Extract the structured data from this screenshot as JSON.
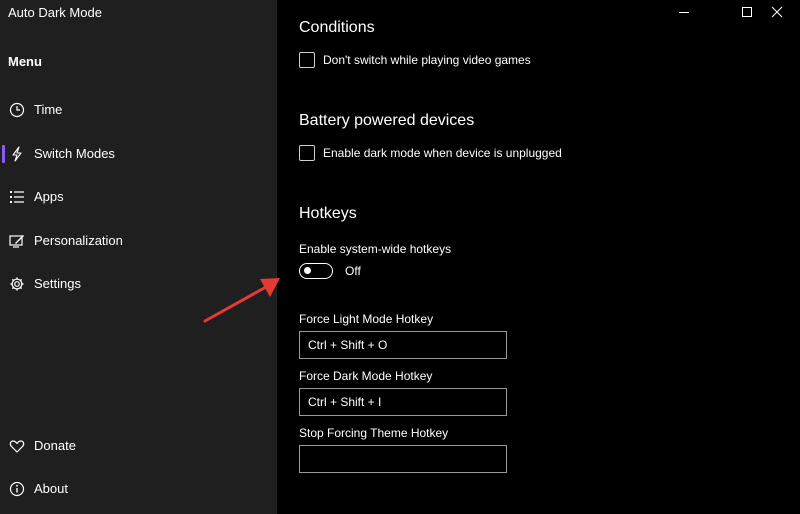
{
  "app": {
    "title": "Auto Dark Mode"
  },
  "window_controls": {
    "minimize": "minimize-icon",
    "maximize": "maximize-icon",
    "close": "close-icon"
  },
  "sidebar": {
    "menu_heading": "Menu",
    "items": [
      {
        "label": "Time",
        "icon": "clock-icon"
      },
      {
        "label": "Switch Modes",
        "icon": "lightning-icon",
        "selected": true
      },
      {
        "label": "Apps",
        "icon": "apps-list-icon"
      },
      {
        "label": "Personalization",
        "icon": "personalization-icon"
      },
      {
        "label": "Settings",
        "icon": "gear-icon"
      }
    ],
    "footer_items": [
      {
        "label": "Donate",
        "icon": "heart-icon"
      },
      {
        "label": "About",
        "icon": "info-icon"
      }
    ]
  },
  "main": {
    "conditions": {
      "title": "Conditions",
      "games_checkbox": {
        "label": "Don't switch while playing video games",
        "checked": false
      }
    },
    "battery": {
      "title": "Battery powered devices",
      "unplugged_checkbox": {
        "label": "Enable dark mode when device is unplugged",
        "checked": false
      }
    },
    "hotkeys": {
      "title": "Hotkeys",
      "enable_label": "Enable system-wide hotkeys",
      "toggle_state": "Off",
      "light_label": "Force Light Mode Hotkey",
      "light_value": "Ctrl + Shift + O",
      "dark_label": "Force Dark Mode Hotkey",
      "dark_value": "Ctrl + Shift + I",
      "stop_label": "Stop Forcing Theme Hotkey",
      "stop_value": ""
    }
  },
  "colors": {
    "sidebar_bg": "#1f1f1f",
    "main_bg": "#000000",
    "selected_indicator": "#8a5cf6",
    "annotation_arrow": "#e53935"
  }
}
